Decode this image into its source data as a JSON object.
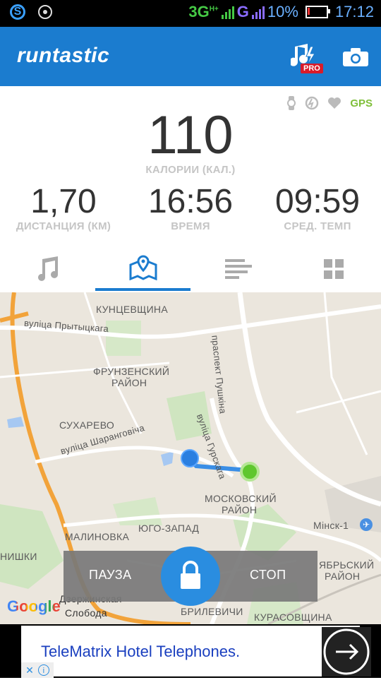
{
  "status_bar": {
    "network_3g": "3G",
    "network_3g_sup": "H+",
    "network_g": "G",
    "battery": "10%",
    "time": "17:12"
  },
  "app_bar": {
    "logo": "runtastic",
    "pro_badge": "PRO",
    "icons": [
      "music-pro-icon",
      "camera-icon"
    ]
  },
  "sensor_icons": [
    "watch-icon",
    "cadence-icon",
    "heart-icon"
  ],
  "gps_label": "GPS",
  "stats": {
    "calories_value": "110",
    "calories_label": "КАЛОРИИ (КАЛ.)",
    "distance_value": "1,70",
    "distance_label": "ДИСТАНЦИЯ (КМ)",
    "time_value": "16:56",
    "time_label": "ВРЕМЯ",
    "pace_value": "09:59",
    "pace_label": "СРЕД. ТЕМП"
  },
  "tabs": [
    "music-icon",
    "map-icon",
    "stats-bars-icon",
    "grid-icon"
  ],
  "active_tab": 1,
  "map": {
    "labels": {
      "kuntsevshchina": "КУНЦЕВЩИНА",
      "prytytskaga": "вуліца Прытыцкага",
      "pushkina": "праспект Пушкіна",
      "frunzenski": "ФРУНЗЕНСКИЙ",
      "raion1": "РАЙОН",
      "sukharevo": "СУХАРЕВО",
      "sharangovicha": "вуліца Шаранговіча",
      "gurskaga": "вуліца Гурскага",
      "moskovski": "МОСКОВСКИЙ",
      "raion2": "РАЙОН",
      "minsk1": "Мінск-1",
      "yugozapad": "ЮГО-ЗАПАД",
      "malinovka": "МАЛИНОВКА",
      "nishki": "НИШКИ",
      "oktyabrski": "ЯБРЬСКИЙ",
      "raion3": "РАЙОН",
      "dzerzhinskaya": "Дзержинская",
      "sloboda": "Слобода",
      "brilevichi": "БРИЛЕВИЧИ",
      "kurasovshchina": "КУРАСОВЩИНА"
    },
    "google_logo": "Google",
    "colors": {
      "route": "#3a8ee6",
      "start_marker": "#2b7fe0",
      "end_marker": "#5fc72e"
    }
  },
  "controls": {
    "pause": "ПАУЗА",
    "stop": "СТОП",
    "lock_icon": "lock-icon"
  },
  "ad": {
    "text": "TeleMatrix Hotel Telephones.",
    "arrow_icon": "arrow-right-icon"
  },
  "colors": {
    "brand_blue": "#1b7ccf",
    "gps_green": "#7fbf3a"
  }
}
